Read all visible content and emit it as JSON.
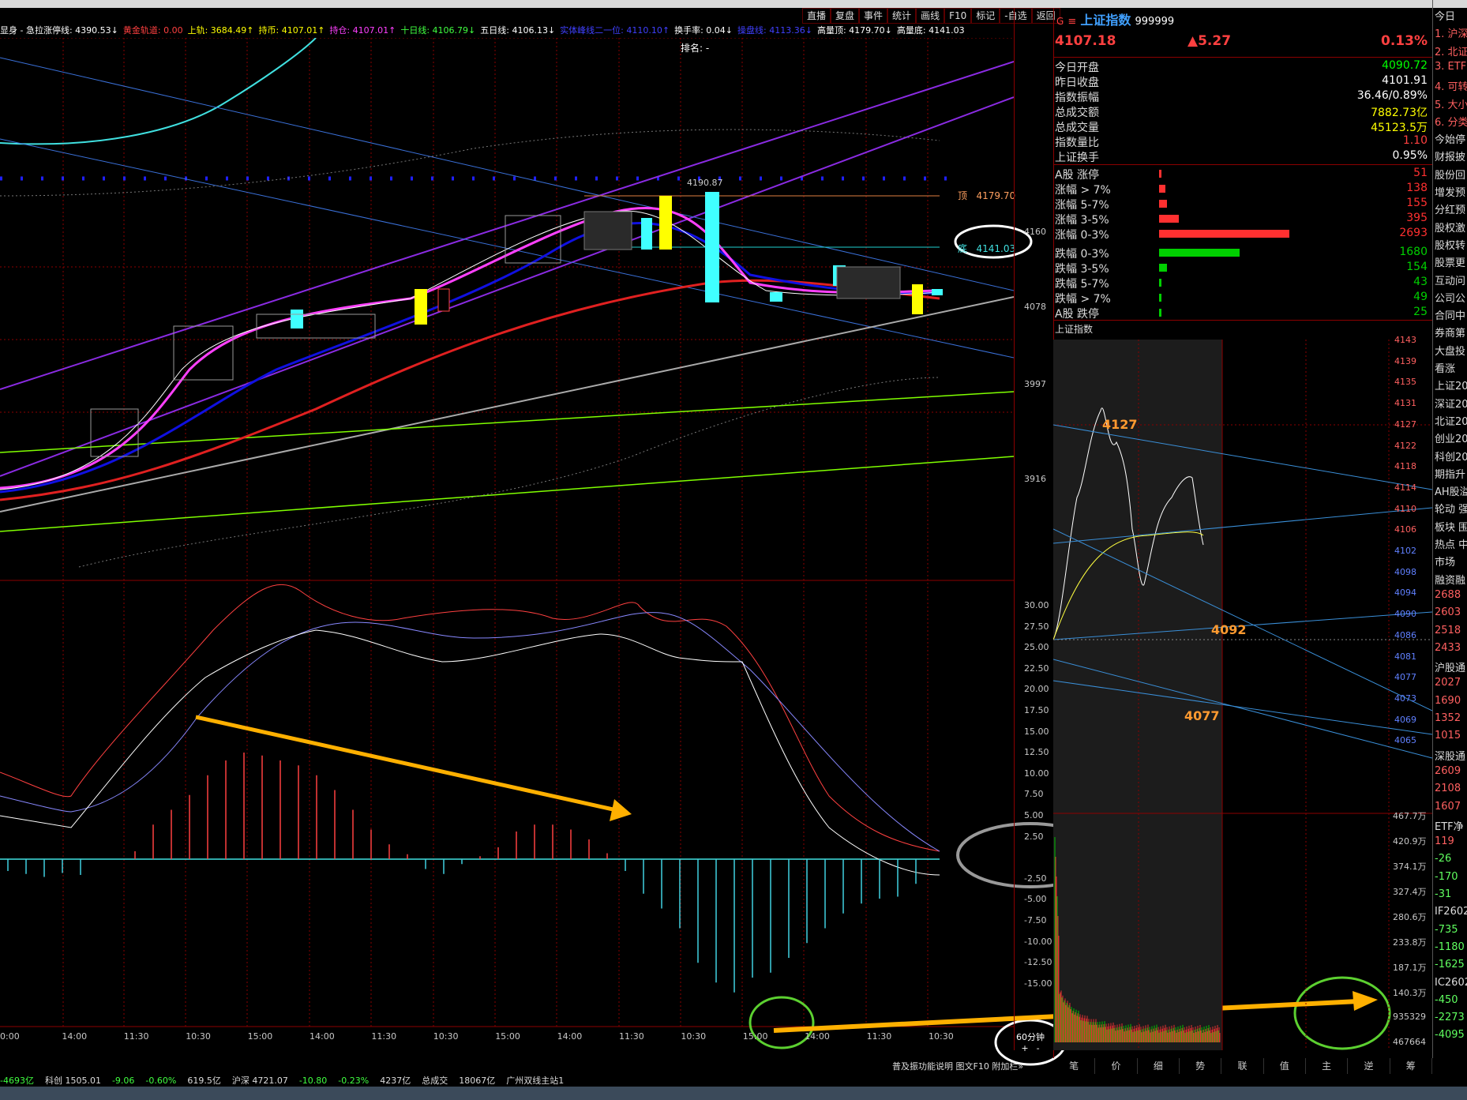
{
  "toolbar": [
    "直播",
    "复盘",
    "事件",
    "统计",
    "画线",
    "F10",
    "标记",
    "-自选",
    "返回"
  ],
  "indicators": [
    {
      "text": "显身 - 急拉涨停线: 4390.53↓",
      "color": "#ffffff"
    },
    {
      "text": "黄金轨道: 0.00",
      "color": "#ff4040"
    },
    {
      "text": "上轨: 3684.49↑",
      "color": "#ffff00"
    },
    {
      "text": "持币: 4107.01↑",
      "color": "#ffff00"
    },
    {
      "text": "持仓: 4107.01↑",
      "color": "#ff40ff"
    },
    {
      "text": "十日线: 4106.79↓",
      "color": "#40ff40"
    },
    {
      "text": "五日线: 4106.13↓",
      "color": "#ffffff"
    },
    {
      "text": "实体峰线二一位: 4110.10↑",
      "color": "#4040ff"
    },
    {
      "text": "换手率: 0.04↓",
      "color": "#ffffff"
    },
    {
      "text": "操盘线: 4113.36↓",
      "color": "#4040ff"
    },
    {
      "text": "高量顶: 4179.70↓",
      "color": "#ffffff"
    },
    {
      "text": "高量底: 4141.03",
      "color": "#ffffff"
    }
  ],
  "rank_label": "排名: -",
  "main_chart": {
    "yticks": [
      "4160",
      "4078",
      "3997",
      "3916"
    ],
    "annotations": {
      "peak_price": "4190.87",
      "top_label": "顶",
      "top_value": "4179.70",
      "bottom_label": "底",
      "bottom_value": "4141.03"
    }
  },
  "macd": {
    "yticks": [
      "30.00",
      "27.50",
      "25.00",
      "22.50",
      "20.00",
      "17.50",
      "15.00",
      "12.50",
      "10.00",
      "7.50",
      "5.00",
      "2.50",
      "-2.50",
      "-5.00",
      "-7.50",
      "-10.00",
      "-12.50",
      "-15.00"
    ]
  },
  "time_axis": [
    "0:00",
    "14:00",
    "11:30",
    "10:30",
    "15:00",
    "14:00",
    "11:30",
    "10:30",
    "15:00",
    "14:00",
    "11:30",
    "10:30",
    "15:00",
    "14:00",
    "11:30",
    "10:30"
  ],
  "period": {
    "label": "60分钟",
    "plus": "+",
    "minus": "-"
  },
  "index": {
    "flag": "G",
    "name": "上证指数",
    "code": "999999",
    "price": "4107.18",
    "change": "▲5.27",
    "pct": "0.13%"
  },
  "stats": [
    {
      "label": "今日开盘",
      "value": "4090.72",
      "color": "#00ff00"
    },
    {
      "label": "昨日收盘",
      "value": "4101.91",
      "color": "#ffffff"
    },
    {
      "label": "指数振幅",
      "value": "36.46/0.89%",
      "color": "#ffffff"
    },
    {
      "label": "总成交额",
      "value": "7882.73亿",
      "color": "#ffff00"
    },
    {
      "label": "总成交量",
      "value": "45123.5万",
      "color": "#ffff00"
    },
    {
      "label": "指数量比",
      "value": "1.10",
      "color": "#ff4040"
    },
    {
      "label": "上证换手",
      "value": "0.95%",
      "color": "#ffffff"
    }
  ],
  "breadth": [
    {
      "label": "A股 涨停",
      "value": "51",
      "color": "#ff3030",
      "frac": 0.02
    },
    {
      "label": "涨幅 > 7%",
      "value": "138",
      "color": "#ff3030",
      "frac": 0.05
    },
    {
      "label": "涨幅 5-7%",
      "value": "155",
      "color": "#ff3030",
      "frac": 0.06
    },
    {
      "label": "涨幅 3-5%",
      "value": "395",
      "color": "#ff3030",
      "frac": 0.15
    },
    {
      "label": "涨幅 0-3%",
      "value": "2693",
      "color": "#ff3030",
      "frac": 1.0
    },
    {
      "label": "跌幅 0-3%",
      "value": "1680",
      "color": "#00d000",
      "frac": 0.62
    },
    {
      "label": "跌幅 3-5%",
      "value": "154",
      "color": "#00d000",
      "frac": 0.06
    },
    {
      "label": "跌幅 5-7%",
      "value": "43",
      "color": "#00d000",
      "frac": 0.02
    },
    {
      "label": "跌幅 > 7%",
      "value": "49",
      "color": "#00d000",
      "frac": 0.02
    },
    {
      "label": "A股 跌停",
      "value": "25",
      "color": "#00d000",
      "frac": 0.01
    }
  ],
  "intraday": {
    "title": "上证指数",
    "yticks": [
      "4143",
      "4139",
      "4135",
      "4131",
      "4127",
      "4122",
      "4118",
      "4114",
      "4110",
      "4106",
      "4102",
      "4098",
      "4094",
      "4090",
      "4086",
      "4081",
      "4077",
      "4073",
      "4069",
      "4065"
    ],
    "vol_ticks": [
      "467.7万",
      "420.9万",
      "374.1万",
      "327.4万",
      "280.6万",
      "233.8万",
      "187.1万",
      "140.3万",
      "935329",
      "467664"
    ],
    "labels": {
      "high": "4127",
      "mid": "4092",
      "low": "4077"
    }
  },
  "bottom_tabs": [
    "笔",
    "价",
    "细",
    "势",
    "联",
    "值",
    "主",
    "逆",
    "筹"
  ],
  "help_text": "普及振功能说明  图文F10  附加栏»",
  "far_right": [
    "今日",
    "1. 沪深",
    "2. 北证",
    "3. ETF",
    "4. 可转",
    "5. 大小",
    "6. 分类",
    "今始停",
    "财报披",
    "股份回",
    "增发预",
    "分红预",
    "股权激",
    "股权转",
    "股票更",
    "互动问",
    "公司公",
    "合同中",
    "券商第",
    "大盘投",
    "看涨",
    "上证20",
    "深证20",
    "北证20",
    "创业20",
    "科创20",
    "期指升",
    "AH股溢",
    "轮动 强",
    "板块 围",
    "热点 中",
    "市场",
    "融资融",
    "2688",
    "2603",
    "2518",
    "2433",
    "沪股通",
    "2027",
    "1690",
    "1352",
    "1015",
    "深股通",
    "2609",
    "2108",
    "1607",
    "ETF净",
    "119",
    "-26",
    "-170",
    "-31",
    "IF2602",
    "-735",
    "-1180",
    "-1625",
    "IC2602",
    "-450",
    "-2273",
    "-4095"
  ],
  "status": [
    "-4693亿",
    "科创 1505.01",
    "-9.06",
    "-0.60%",
    "619.5亿",
    "沪深 4721.07",
    "-10.80",
    "-0.23%",
    "4237亿",
    "总成交",
    "18067亿",
    "广州双线主站1"
  ]
}
